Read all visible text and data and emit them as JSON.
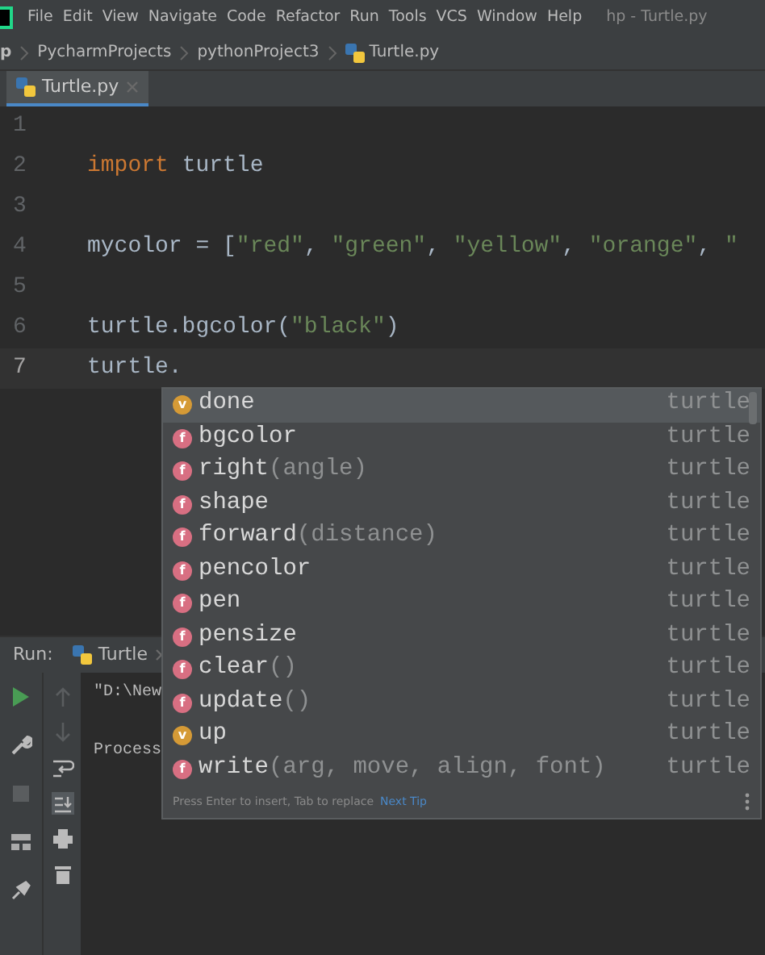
{
  "menu_bar": {
    "items": [
      "File",
      "Edit",
      "View",
      "Navigate",
      "Code",
      "Refactor",
      "Run",
      "Tools",
      "VCS",
      "Window",
      "Help"
    ],
    "title": "hp - Turtle.py"
  },
  "breadcrumb": [
    "p",
    "PycharmProjects",
    "pythonProject3",
    "Turtle.py"
  ],
  "editor_tabs": [
    {
      "label": "Turtle.py",
      "selected": true
    }
  ],
  "editor": {
    "lines": [
      {
        "number": "1"
      },
      {
        "number": "2",
        "code": [
          {
            "kind": "keyword",
            "text": "import"
          },
          {
            "kind": "plain",
            "text": " turtle"
          }
        ]
      },
      {
        "number": "3"
      },
      {
        "number": "4",
        "code": [
          {
            "kind": "plain",
            "text": "mycolor = ["
          },
          {
            "kind": "string",
            "text": "\"red\""
          },
          {
            "kind": "plain",
            "text": ", "
          },
          {
            "kind": "string",
            "text": "\"green\""
          },
          {
            "kind": "plain",
            "text": ", "
          },
          {
            "kind": "string",
            "text": "\"yellow\""
          },
          {
            "kind": "plain",
            "text": ", "
          },
          {
            "kind": "string",
            "text": "\"orange\""
          },
          {
            "kind": "plain",
            "text": ", "
          },
          {
            "kind": "string",
            "text": "\""
          }
        ]
      },
      {
        "number": "5"
      },
      {
        "number": "6",
        "code": [
          {
            "kind": "plain",
            "text": "turtle.bgcolor("
          },
          {
            "kind": "string",
            "text": "\"black\""
          },
          {
            "kind": "plain",
            "text": ")"
          }
        ]
      },
      {
        "number": "7",
        "current": true,
        "code": [
          {
            "kind": "plain",
            "text": "turtle."
          }
        ]
      }
    ]
  },
  "completion": {
    "items": [
      {
        "kind": "variable",
        "badge": "v",
        "name": "done",
        "type": "turtle",
        "selected": true
      },
      {
        "kind": "function",
        "badge": "f",
        "name": "bgcolor",
        "type": "turtle",
        "selected": false
      },
      {
        "kind": "function",
        "badge": "f",
        "name": "right",
        "params": "(angle)",
        "type": "turtle",
        "selected": false
      },
      {
        "kind": "function",
        "badge": "f",
        "name": "shape",
        "type": "turtle",
        "selected": false
      },
      {
        "kind": "function",
        "badge": "f",
        "name": "forward",
        "params": "(distance)",
        "type": "turtle",
        "selected": false
      },
      {
        "kind": "function",
        "badge": "f",
        "name": "pencolor",
        "type": "turtle",
        "selected": false
      },
      {
        "kind": "function",
        "badge": "f",
        "name": "pen",
        "type": "turtle",
        "selected": false
      },
      {
        "kind": "function",
        "badge": "f",
        "name": "pensize",
        "type": "turtle",
        "selected": false
      },
      {
        "kind": "function",
        "badge": "f",
        "name": "clear",
        "params": "()",
        "type": "turtle",
        "selected": false
      },
      {
        "kind": "function",
        "badge": "f",
        "name": "update",
        "params": "()",
        "type": "turtle",
        "selected": false
      },
      {
        "kind": "variable",
        "badge": "v",
        "name": "up",
        "type": "turtle",
        "selected": false
      },
      {
        "kind": "function",
        "badge": "f",
        "name": "write",
        "params": "(arg, move, align, font)",
        "type": "turtle",
        "selected": false
      }
    ],
    "hint": "Press Enter to insert, Tab to replace",
    "hint_link": "Next Tip"
  },
  "run_panel": {
    "label": "Run:",
    "tab": "Turtle",
    "output": [
      "\"D:\\New",
      "Process"
    ]
  }
}
